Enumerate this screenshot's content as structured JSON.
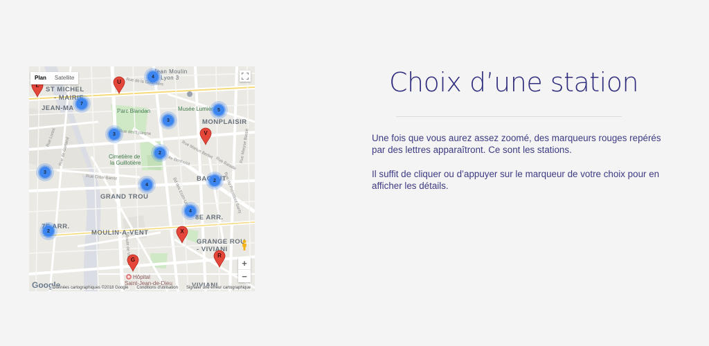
{
  "main": {
    "title": "Choix d’une station",
    "paragraphs": [
      "Une fois que vous aurez assez zoomé, des marqueurs rouges repérés par des lettres apparaîtront. Ce sont les stations.",
      "Il suffit de cliquer ou d’appuyer sur le marqueur de votre choix pour en afficher les détails."
    ]
  },
  "map": {
    "map_type": {
      "plan": "Plan",
      "satellite": "Satellite",
      "selected": "Plan"
    },
    "zoom": {
      "in": "+",
      "out": "−"
    },
    "attribution": {
      "data": "Données cartographiques ©2018 Google",
      "terms": "Conditions d'utilisation",
      "report": "Signaler une erreur cartographique"
    },
    "logo": "Google",
    "place_labels": [
      "ST MICHEL",
      "- MAIRIE",
      "JEAN-MA",
      "MONPLAISIR",
      "BACHUT",
      "GRAND TROU",
      "8E ARR.",
      "7E ARR.",
      "MOULIN-A-VENT",
      "GRANGE ROU",
      "- VIVIANI",
      "VIVIANI",
      "Jean Moulin",
      "Lyon 3"
    ],
    "poi_labels": [
      "Parc Blandan",
      "Musée Lumière",
      "Cimetière de",
      "la Guillotière",
      "Hôpital",
      "Saint-Jean-de-Dieu"
    ],
    "street_labels": [
      "Rue Croix-Barret",
      "Rue de l'Epargne",
      "Av Berthelot",
      "Rue Marius Berliet",
      "Rue Bataille",
      "Rue Lortet",
      "Rue de Gerland",
      "Rue Maryse Bastié",
      "Route de Vienne",
      "Bd des Etats-Unis",
      "Rue du Président Santy",
      "Rue de la Guillotière"
    ],
    "clusters": [
      "4",
      "7",
      "5",
      "3",
      "3",
      "2",
      "2",
      "4",
      "4",
      "3",
      "2"
    ],
    "stations": [
      "U",
      "V",
      "L",
      "X",
      "G",
      "R"
    ],
    "colors": {
      "cluster": "#3e86ef",
      "station_pin": "#e4473a",
      "title": "#2f2d7d",
      "text": "#3c3a82"
    },
    "icons": [
      "fullscreen-icon",
      "pegman-icon",
      "hospital-icon",
      "poi-icon"
    ]
  }
}
